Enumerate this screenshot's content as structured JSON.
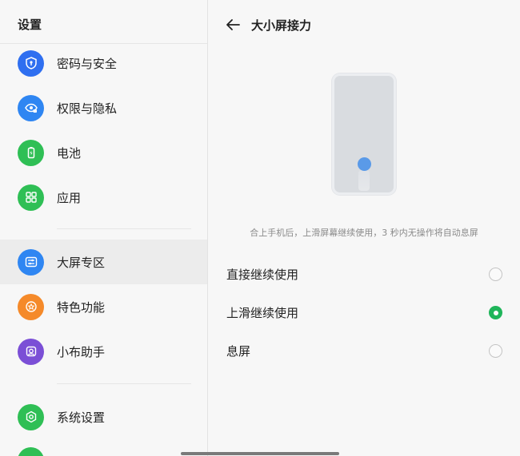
{
  "sidebar": {
    "title": "设置",
    "items": [
      {
        "label": "密码与安全",
        "icon": "shield-icon",
        "color": "#2f6ff0"
      },
      {
        "label": "权限与隐私",
        "icon": "eye-lock-icon",
        "color": "#2f86f2"
      },
      {
        "label": "电池",
        "icon": "battery-icon",
        "color": "#2fbf55"
      },
      {
        "label": "应用",
        "icon": "apps-grid-icon",
        "color": "#2fbf55"
      },
      {
        "label": "大屏专区",
        "icon": "sliders-icon",
        "color": "#2f86f2",
        "selected": true
      },
      {
        "label": "特色功能",
        "icon": "star-icon",
        "color": "#f58a2a"
      },
      {
        "label": "小布助手",
        "icon": "assistant-icon",
        "color": "#7b4fd6"
      },
      {
        "label": "系统设置",
        "icon": "hexagon-gear-icon",
        "color": "#2fbf55"
      },
      {
        "label": "",
        "icon": "partial-icon",
        "color": "#2fbf55"
      }
    ]
  },
  "main": {
    "title": "大小屏接力",
    "description": "合上手机后，上滑屏幕继续使用，3 秒内无操作将自动息屏",
    "options": [
      {
        "label": "直接继续使用",
        "selected": false
      },
      {
        "label": "上滑继续使用",
        "selected": true
      },
      {
        "label": "息屏",
        "selected": false
      }
    ],
    "accent_color": "#1fb55a"
  }
}
